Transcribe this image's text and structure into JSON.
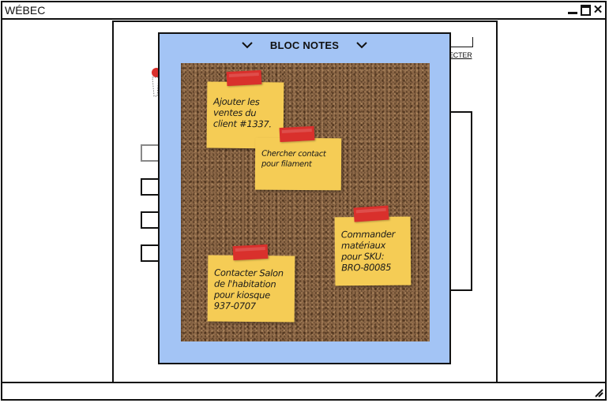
{
  "window": {
    "title": "WÉBEC"
  },
  "background": {
    "link_label": "ECTER"
  },
  "modal": {
    "title": "BLOC NOTES",
    "notes": [
      {
        "text": "Ajouter les\nventes du\nclient #1337."
      },
      {
        "text": "Chercher contact\npour filament"
      },
      {
        "text": "Commander\nmatériaux\npour SKU:\nBRO-80085"
      },
      {
        "text": "Contacter Salon\nde l'habitation\npour kiosque\n937-0707"
      }
    ]
  },
  "colors": {
    "modal_bg": "#a3c4f5",
    "cork": "#8a6646",
    "note": "#f5cc55",
    "tape": "#d9302c"
  },
  "icons": {
    "minimize": "minimize-icon",
    "maximize": "maximize-icon",
    "close": "close-icon",
    "chevron_left": "chevron-down-icon",
    "chevron_right": "chevron-down-icon",
    "resize": "resize-grip-icon"
  }
}
